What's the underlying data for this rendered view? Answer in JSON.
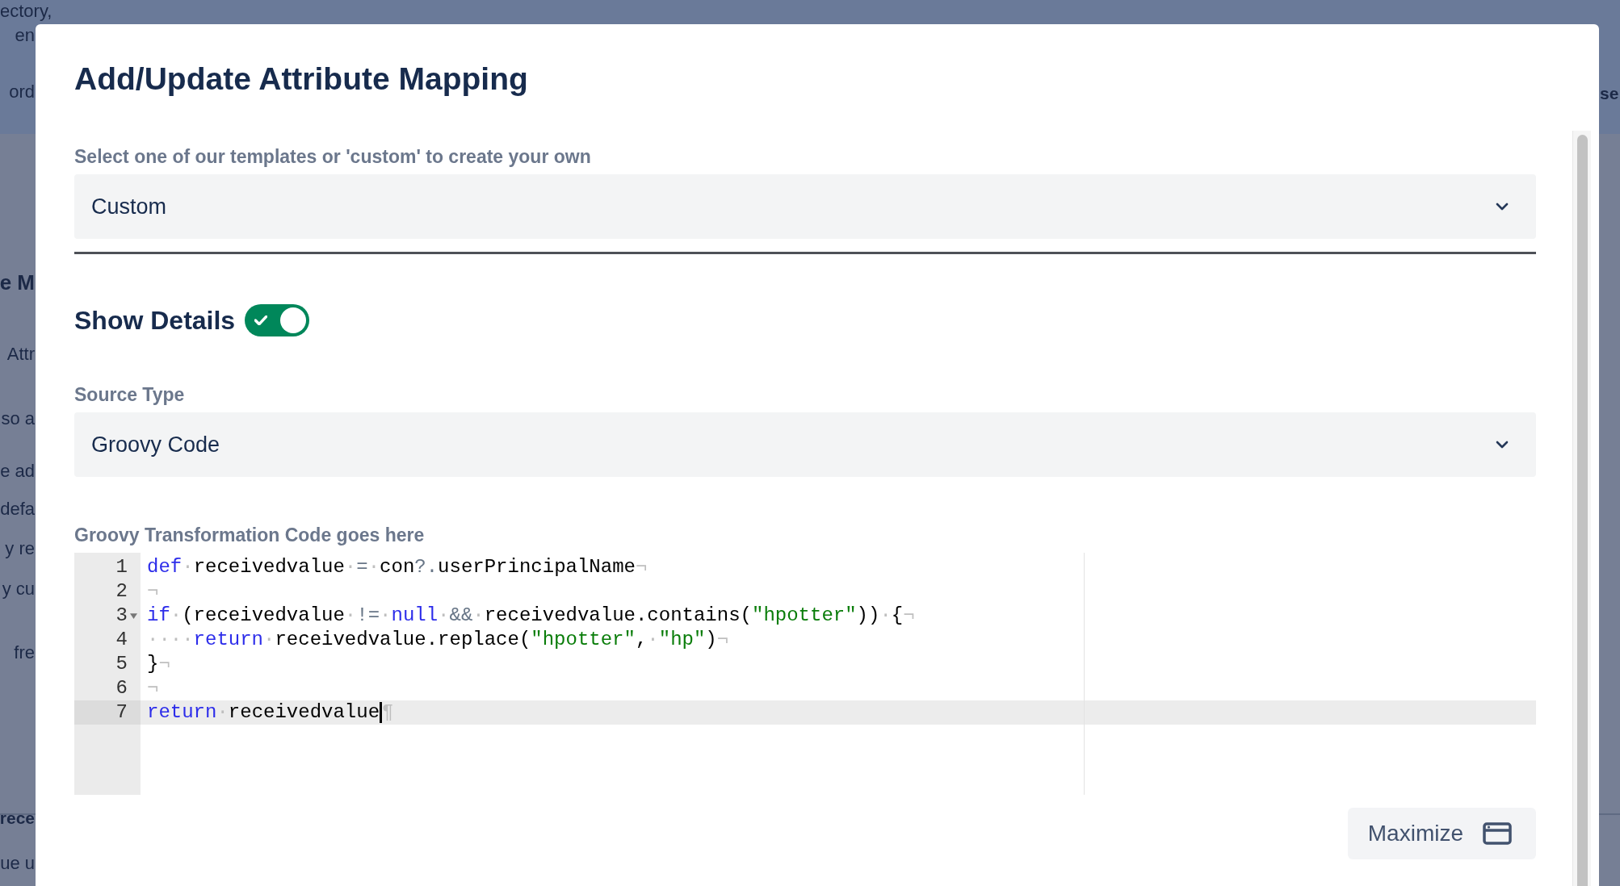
{
  "background": {
    "fragments": [
      {
        "text": "ectory,",
        "kind": "body"
      },
      {
        "text": "en",
        "kind": "body"
      },
      {
        "text": "ord",
        "kind": "body"
      },
      {
        "text": "se",
        "kind": "strong"
      },
      {
        "text": "e M",
        "kind": "heading"
      },
      {
        "text": "Attr",
        "kind": "body"
      },
      {
        "text": "so a",
        "kind": "body"
      },
      {
        "text": "e ad",
        "kind": "body"
      },
      {
        "text": "defa",
        "kind": "body"
      },
      {
        "text": "y re",
        "kind": "body"
      },
      {
        "text": "y cu",
        "kind": "body"
      },
      {
        "text": "fre",
        "kind": "body"
      },
      {
        "text": "rece",
        "kind": "strong"
      },
      {
        "text": "ue u",
        "kind": "body"
      }
    ]
  },
  "dialog": {
    "title": "Add/Update Attribute Mapping",
    "template": {
      "label": "Select one of our templates or 'custom' to create your own",
      "value": "Custom"
    },
    "show_details": {
      "label": "Show Details",
      "on": true
    },
    "source_type": {
      "label": "Source Type",
      "value": "Groovy Code"
    },
    "editor": {
      "label": "Groovy Transformation Code goes here",
      "lines": [
        {
          "number": "1",
          "foldable": false,
          "active": false,
          "cursor": false,
          "tokens": [
            {
              "kind": "keyword",
              "text": "def"
            },
            {
              "kind": "invisible",
              "text": "·"
            },
            {
              "kind": "plain",
              "text": "receivedvalue"
            },
            {
              "kind": "invisible",
              "text": "·"
            },
            {
              "kind": "operator",
              "text": "="
            },
            {
              "kind": "invisible",
              "text": "·"
            },
            {
              "kind": "plain",
              "text": "con"
            },
            {
              "kind": "operator",
              "text": "?."
            },
            {
              "kind": "plain",
              "text": "userPrincipalName"
            },
            {
              "kind": "invisible",
              "text": "¬"
            }
          ]
        },
        {
          "number": "2",
          "foldable": false,
          "active": false,
          "cursor": false,
          "tokens": [
            {
              "kind": "invisible",
              "text": "¬"
            }
          ]
        },
        {
          "number": "3",
          "foldable": true,
          "active": false,
          "cursor": false,
          "tokens": [
            {
              "kind": "keyword",
              "text": "if"
            },
            {
              "kind": "invisible",
              "text": "·"
            },
            {
              "kind": "plain",
              "text": "(receivedvalue"
            },
            {
              "kind": "invisible",
              "text": "·"
            },
            {
              "kind": "operator",
              "text": "!="
            },
            {
              "kind": "invisible",
              "text": "·"
            },
            {
              "kind": "keyword",
              "text": "null"
            },
            {
              "kind": "invisible",
              "text": "·"
            },
            {
              "kind": "operator",
              "text": "&&"
            },
            {
              "kind": "invisible",
              "text": "·"
            },
            {
              "kind": "plain",
              "text": "receivedvalue.contains("
            },
            {
              "kind": "string",
              "text": "\"hpotter\""
            },
            {
              "kind": "plain",
              "text": "))"
            },
            {
              "kind": "invisible",
              "text": "·"
            },
            {
              "kind": "plain",
              "text": "{"
            },
            {
              "kind": "invisible",
              "text": "¬"
            }
          ]
        },
        {
          "number": "4",
          "foldable": false,
          "active": false,
          "cursor": false,
          "tokens": [
            {
              "kind": "invisible",
              "text": "····"
            },
            {
              "kind": "keyword",
              "text": "return"
            },
            {
              "kind": "invisible",
              "text": "·"
            },
            {
              "kind": "plain",
              "text": "receivedvalue.replace("
            },
            {
              "kind": "string",
              "text": "\"hpotter\""
            },
            {
              "kind": "plain",
              "text": ","
            },
            {
              "kind": "invisible",
              "text": "·"
            },
            {
              "kind": "string",
              "text": "\"hp\""
            },
            {
              "kind": "plain",
              "text": ")"
            },
            {
              "kind": "invisible",
              "text": "¬"
            }
          ]
        },
        {
          "number": "5",
          "foldable": false,
          "active": false,
          "cursor": false,
          "tokens": [
            {
              "kind": "plain",
              "text": "}"
            },
            {
              "kind": "invisible",
              "text": "¬"
            }
          ]
        },
        {
          "number": "6",
          "foldable": false,
          "active": false,
          "cursor": false,
          "tokens": [
            {
              "kind": "invisible",
              "text": "¬"
            }
          ]
        },
        {
          "number": "7",
          "foldable": false,
          "active": true,
          "cursor": true,
          "tokens": [
            {
              "kind": "keyword",
              "text": "return"
            },
            {
              "kind": "invisible",
              "text": "·"
            },
            {
              "kind": "plain",
              "text": "receivedvalue"
            },
            {
              "kind": "invisible",
              "text": "¶"
            }
          ]
        }
      ]
    },
    "maximize_button": "Maximize"
  }
}
